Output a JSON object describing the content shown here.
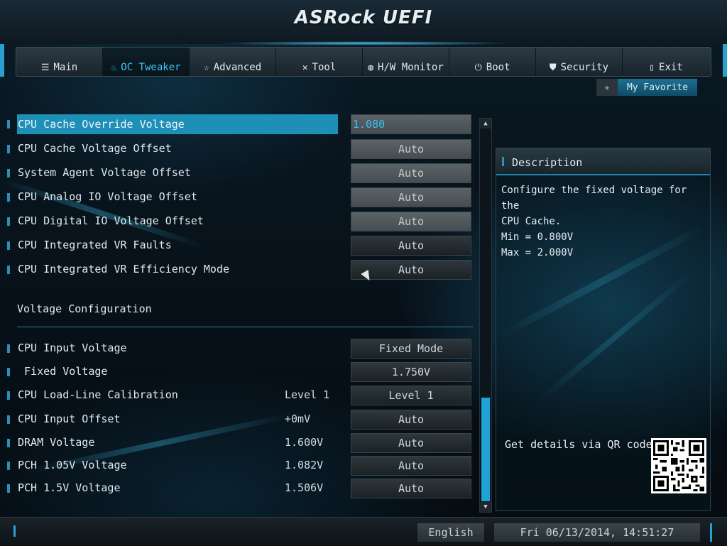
{
  "header": {
    "title": "ASRock UEFI"
  },
  "nav": {
    "tabs": [
      {
        "label": "Main",
        "icon": "list-icon",
        "glyph": "☰",
        "active": false
      },
      {
        "label": "OC Tweaker",
        "icon": "flame-icon",
        "glyph": "♨",
        "active": true
      },
      {
        "label": "Advanced",
        "icon": "star-icon",
        "glyph": "☆",
        "active": false
      },
      {
        "label": "Tool",
        "icon": "tools-icon",
        "glyph": "✕",
        "active": false
      },
      {
        "label": "H/W Monitor",
        "icon": "monitor-icon",
        "glyph": "◍",
        "active": false
      },
      {
        "label": "Boot",
        "icon": "power-icon",
        "glyph": "⏻",
        "active": false
      },
      {
        "label": "Security",
        "icon": "shield-icon",
        "glyph": "⛊",
        "active": false
      },
      {
        "label": "Exit",
        "icon": "exit-door-icon",
        "glyph": "▯",
        "active": false
      }
    ]
  },
  "favorite": {
    "label": "My Favorite",
    "icon": "star-icon",
    "glyph": "★"
  },
  "settings": {
    "r0": {
      "label": "CPU Cache Override Voltage",
      "value": "1.080"
    },
    "r1": {
      "label": "CPU Cache Voltage Offset",
      "value": "Auto"
    },
    "r2": {
      "label": "System Agent Voltage Offset",
      "value": "Auto"
    },
    "r3": {
      "label": "CPU Analog IO Voltage Offset",
      "value": "Auto"
    },
    "r4": {
      "label": "CPU Digital IO Voltage Offset",
      "value": "Auto"
    },
    "r5": {
      "label": "CPU Integrated VR Faults",
      "value": "Auto"
    },
    "r6": {
      "label": "CPU Integrated VR Efficiency Mode",
      "value": "Auto"
    }
  },
  "section": {
    "title": "Voltage Configuration"
  },
  "voltage": {
    "r0": {
      "label": "CPU Input Voltage",
      "current": "",
      "value": "Fixed Mode"
    },
    "r1": {
      "label": " Fixed Voltage",
      "current": "",
      "value": "1.750V"
    },
    "r2": {
      "label": "CPU Load-Line Calibration",
      "current": "Level 1",
      "value": "Level 1"
    },
    "r3": {
      "label": "CPU Input Offset",
      "current": "+0mV",
      "value": "Auto"
    },
    "r4": {
      "label": "DRAM Voltage",
      "current": "1.600V",
      "value": "Auto"
    },
    "r5": {
      "label": "PCH 1.05V Voltage",
      "current": "1.082V",
      "value": "Auto"
    },
    "r6": {
      "label": "PCH 1.5V Voltage",
      "current": "1.506V",
      "value": "Auto"
    }
  },
  "scrollbar": {
    "up": "▲",
    "down": "▼"
  },
  "description": {
    "title": "Description",
    "text_line1": "Configure the fixed voltage for the",
    "text_line2": "CPU Cache.",
    "text_line3": "Min = 0.800V",
    "text_line4": "Max = 2.000V",
    "qr_label": "Get details via QR code"
  },
  "footer": {
    "language": "English",
    "datetime": "Fri 06/13/2014, 14:51:27"
  },
  "colors": {
    "accent": "#1fa2d6",
    "selected_row": "#1e8fb6",
    "active_tab_text": "#3ac8f2"
  }
}
